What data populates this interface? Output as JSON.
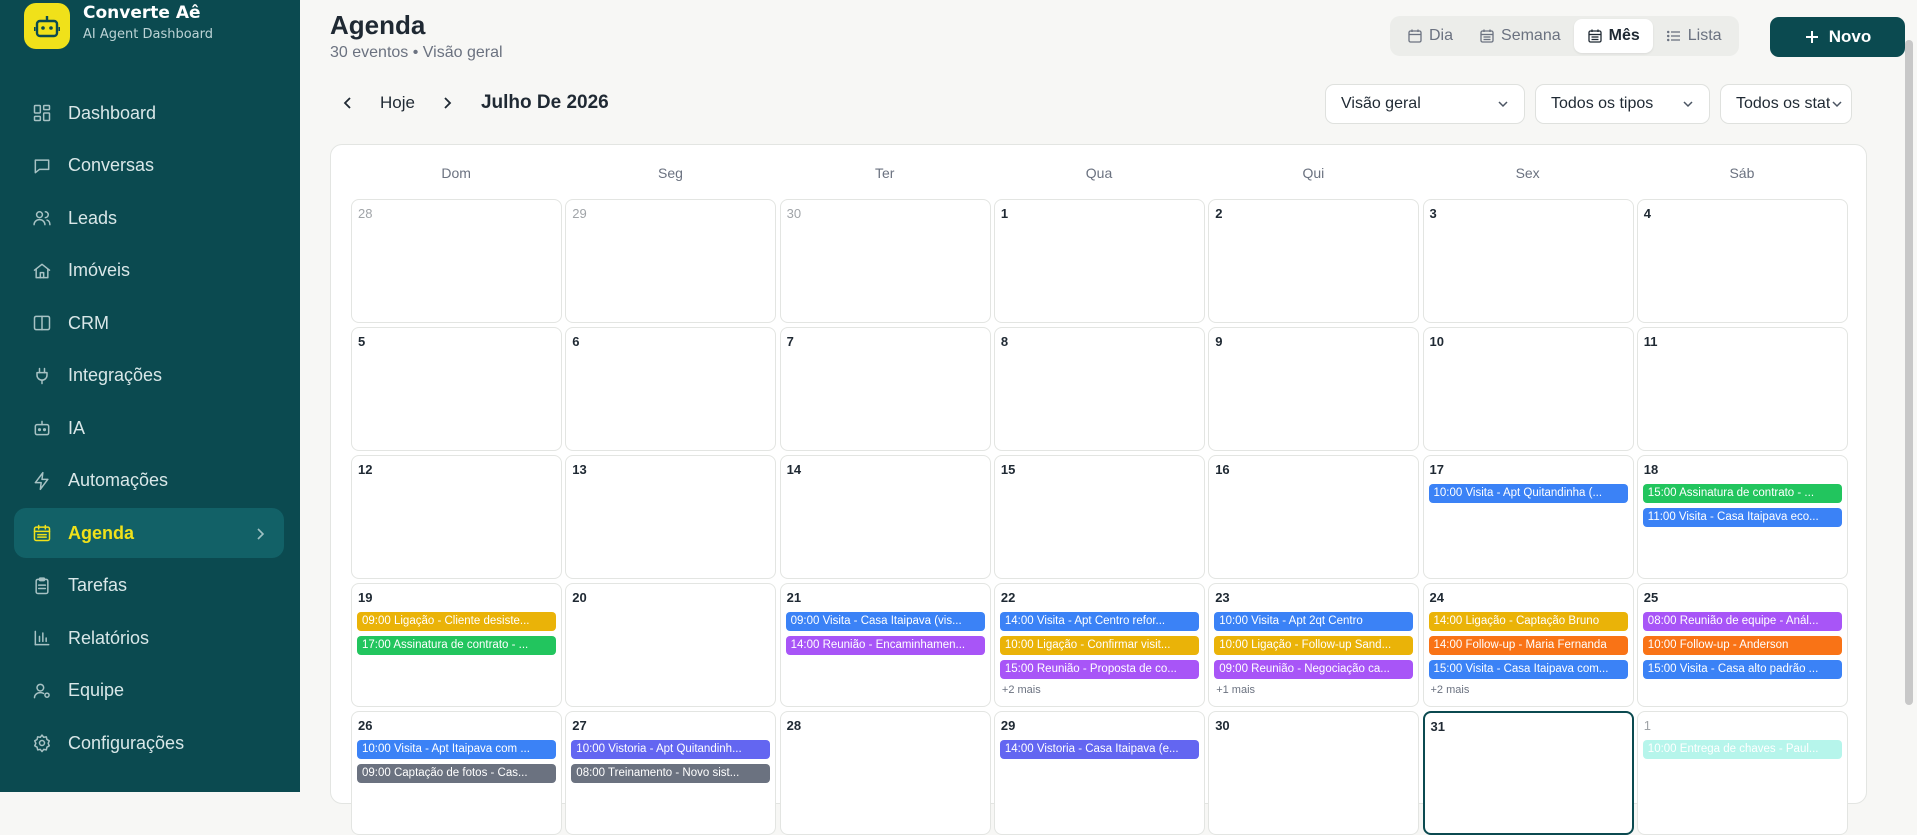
{
  "brand": {
    "name": "Converte Aê",
    "subtitle": "AI Agent Dashboard"
  },
  "nav": [
    {
      "label": "Dashboard",
      "icon": "dashboard-icon"
    },
    {
      "label": "Conversas",
      "icon": "chat-icon"
    },
    {
      "label": "Leads",
      "icon": "users-icon"
    },
    {
      "label": "Imóveis",
      "icon": "home-icon"
    },
    {
      "label": "CRM",
      "icon": "columns-icon"
    },
    {
      "label": "Integrações",
      "icon": "plug-icon"
    },
    {
      "label": "IA",
      "icon": "bot-icon"
    },
    {
      "label": "Automações",
      "icon": "zap-icon"
    },
    {
      "label": "Agenda",
      "icon": "calendar-icon",
      "active": true
    },
    {
      "label": "Tarefas",
      "icon": "clipboard-icon"
    },
    {
      "label": "Relatórios",
      "icon": "bar-chart-icon"
    },
    {
      "label": "Equipe",
      "icon": "user-gear-icon"
    },
    {
      "label": "Configurações",
      "icon": "settings-icon"
    }
  ],
  "header": {
    "title": "Agenda",
    "subtitle": "30 eventos • Visão geral"
  },
  "views": [
    {
      "label": "Dia",
      "icon": "calendar-icon"
    },
    {
      "label": "Semana",
      "icon": "calendar-week-icon"
    },
    {
      "label": "Mês",
      "icon": "calendar-month-icon",
      "active": true
    },
    {
      "label": "Lista",
      "icon": "list-icon"
    }
  ],
  "new_button": "Novo",
  "toolbar": {
    "today": "Hoje",
    "month": "Julho De 2026"
  },
  "filters": [
    {
      "value": "Visão geral"
    },
    {
      "value": "Todos os tipos"
    },
    {
      "value": "Todos os stat"
    }
  ],
  "weekdays": [
    "Dom",
    "Seg",
    "Ter",
    "Qua",
    "Qui",
    "Sex",
    "Sáb"
  ],
  "colors": {
    "sidebar": "#0b4a50",
    "accent": "#f0e11a",
    "blue": "#3b82f6",
    "amber": "#eab308",
    "purple": "#a855f7",
    "green": "#22c55e",
    "orange": "#f97316",
    "indigo": "#6366f1",
    "gray": "#6b7280",
    "teal": "#5eead4"
  },
  "weeks": [
    [
      {
        "d": "28",
        "out": true
      },
      {
        "d": "29",
        "out": true
      },
      {
        "d": "30",
        "out": true
      },
      {
        "d": "1"
      },
      {
        "d": "2"
      },
      {
        "d": "3"
      },
      {
        "d": "4"
      }
    ],
    [
      {
        "d": "5"
      },
      {
        "d": "6"
      },
      {
        "d": "7"
      },
      {
        "d": "8"
      },
      {
        "d": "9"
      },
      {
        "d": "10"
      },
      {
        "d": "11"
      }
    ],
    [
      {
        "d": "12"
      },
      {
        "d": "13"
      },
      {
        "d": "14"
      },
      {
        "d": "15"
      },
      {
        "d": "16"
      },
      {
        "d": "17",
        "events": [
          {
            "t": "10:00 Visita - Apt Quitandinha (...",
            "c": "blue"
          }
        ]
      },
      {
        "d": "18",
        "events": [
          {
            "t": "15:00 Assinatura de contrato - ...",
            "c": "green"
          },
          {
            "t": "11:00 Visita - Casa Itaipava eco...",
            "c": "blue"
          }
        ]
      }
    ],
    [
      {
        "d": "19",
        "events": [
          {
            "t": "09:00 Ligação - Cliente desiste...",
            "c": "amber"
          },
          {
            "t": "17:00 Assinatura de contrato - ...",
            "c": "green"
          }
        ]
      },
      {
        "d": "20"
      },
      {
        "d": "21",
        "events": [
          {
            "t": "09:00 Visita - Casa Itaipava (vis...",
            "c": "blue"
          },
          {
            "t": "14:00 Reunião - Encaminhamen...",
            "c": "purple"
          }
        ]
      },
      {
        "d": "22",
        "events": [
          {
            "t": "14:00 Visita - Apt Centro refor...",
            "c": "blue"
          },
          {
            "t": "10:00 Ligação - Confirmar visit...",
            "c": "amber"
          },
          {
            "t": "15:00 Reunião - Proposta de co...",
            "c": "purple"
          }
        ],
        "more": "+2 mais"
      },
      {
        "d": "23",
        "events": [
          {
            "t": "10:00 Visita - Apt 2qt Centro",
            "c": "blue"
          },
          {
            "t": "10:00 Ligação - Follow-up Sand...",
            "c": "amber"
          },
          {
            "t": "09:00 Reunião - Negociação ca...",
            "c": "purple"
          }
        ],
        "more": "+1 mais"
      },
      {
        "d": "24",
        "events": [
          {
            "t": "14:00 Ligação - Captação Bruno",
            "c": "amber"
          },
          {
            "t": "14:00 Follow-up - Maria Fernanda",
            "c": "orange"
          },
          {
            "t": "15:00 Visita - Casa Itaipava com...",
            "c": "blue"
          }
        ],
        "more": "+2 mais"
      },
      {
        "d": "25",
        "events": [
          {
            "t": "08:00 Reunião de equipe - Anál...",
            "c": "purple"
          },
          {
            "t": "10:00 Follow-up - Anderson",
            "c": "orange"
          },
          {
            "t": "15:00 Visita - Casa alto padrão ...",
            "c": "blue"
          }
        ]
      }
    ],
    [
      {
        "d": "26",
        "events": [
          {
            "t": "10:00 Visita - Apt Itaipava com ...",
            "c": "blue"
          },
          {
            "t": "09:00 Captação de fotos - Cas...",
            "c": "gray"
          }
        ]
      },
      {
        "d": "27",
        "events": [
          {
            "t": "10:00 Vistoria - Apt Quitandinh...",
            "c": "indigo"
          },
          {
            "t": "08:00 Treinamento - Novo sist...",
            "c": "gray"
          }
        ]
      },
      {
        "d": "28"
      },
      {
        "d": "29",
        "events": [
          {
            "t": "14:00 Vistoria - Casa Itaipava (e...",
            "c": "indigo"
          }
        ]
      },
      {
        "d": "30"
      },
      {
        "d": "31",
        "today": true
      },
      {
        "d": "1",
        "out": true,
        "events": [
          {
            "t": "10:00 Entrega de chaves - Paul...",
            "c": "teal"
          }
        ]
      }
    ]
  ]
}
